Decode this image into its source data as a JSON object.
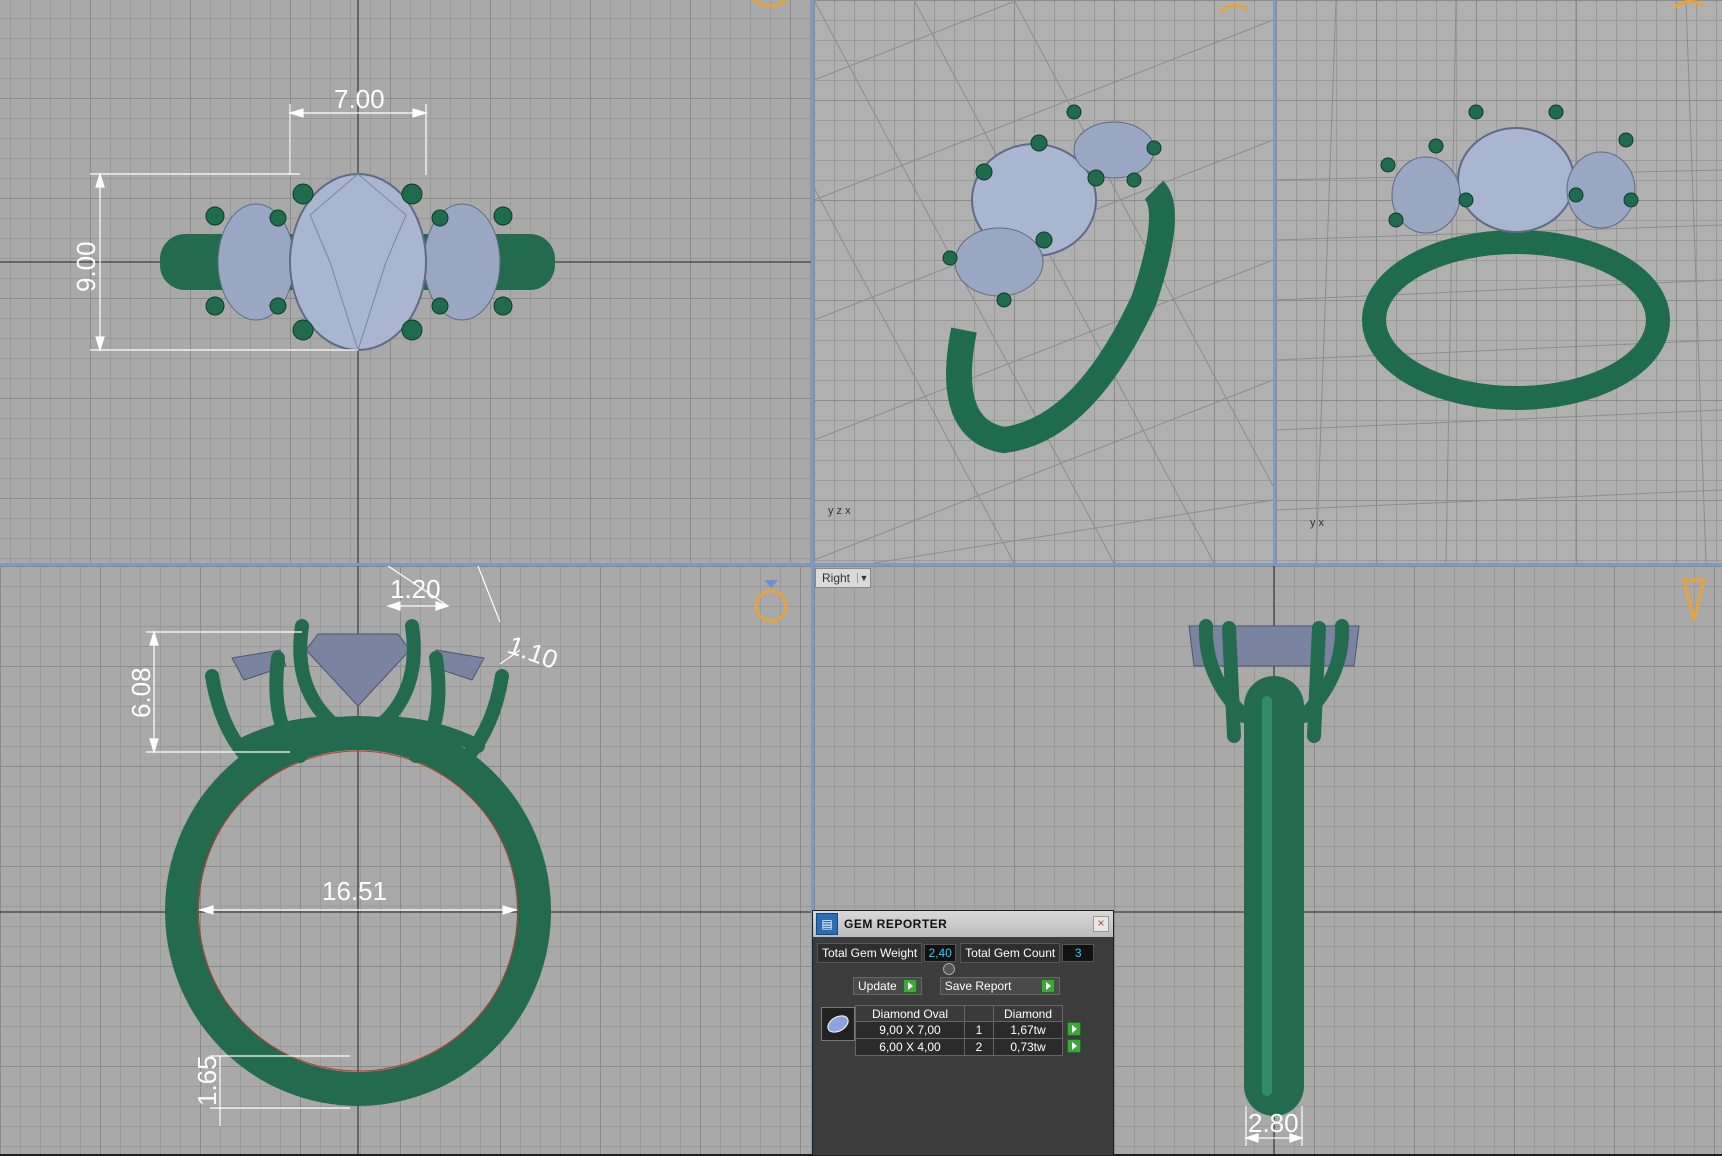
{
  "viewports": {
    "top": {
      "dims": {
        "width": "7.00",
        "height": "9.00"
      }
    },
    "front": {
      "dims": {
        "prong": "1.20",
        "wire": "1.10",
        "setting_height": "6.08",
        "inner_diameter": "16.51",
        "shank": "1.65"
      }
    },
    "right": {
      "view_label": "Right",
      "dims": {
        "shank_width": "2.80"
      }
    }
  },
  "colors": {
    "metal": "#2f8a66",
    "metal_dark": "#17513b",
    "gem": "#a9b6cf",
    "gem_dark": "#6f7b94",
    "grid_bg": "#a9a9a9",
    "viewport_separator": "#7f99c7",
    "gizmo": "#e7a33c"
  },
  "gem_reporter": {
    "title": "GEM REPORTER",
    "close_icon": "close-icon",
    "total_weight_label": "Total Gem Weight",
    "total_weight_value": "2,40",
    "total_count_label": "Total Gem Count",
    "total_count_value": "3",
    "update_label": "Update",
    "save_report_label": "Save Report",
    "table_header": [
      "Diamond Oval",
      "",
      "Diamond"
    ],
    "rows": [
      {
        "size": "9,00 X 7,00",
        "qty": "1",
        "weight": "1,67tw"
      },
      {
        "size": "6,00 X 4,00",
        "qty": "2",
        "weight": "0,73tw"
      }
    ]
  }
}
